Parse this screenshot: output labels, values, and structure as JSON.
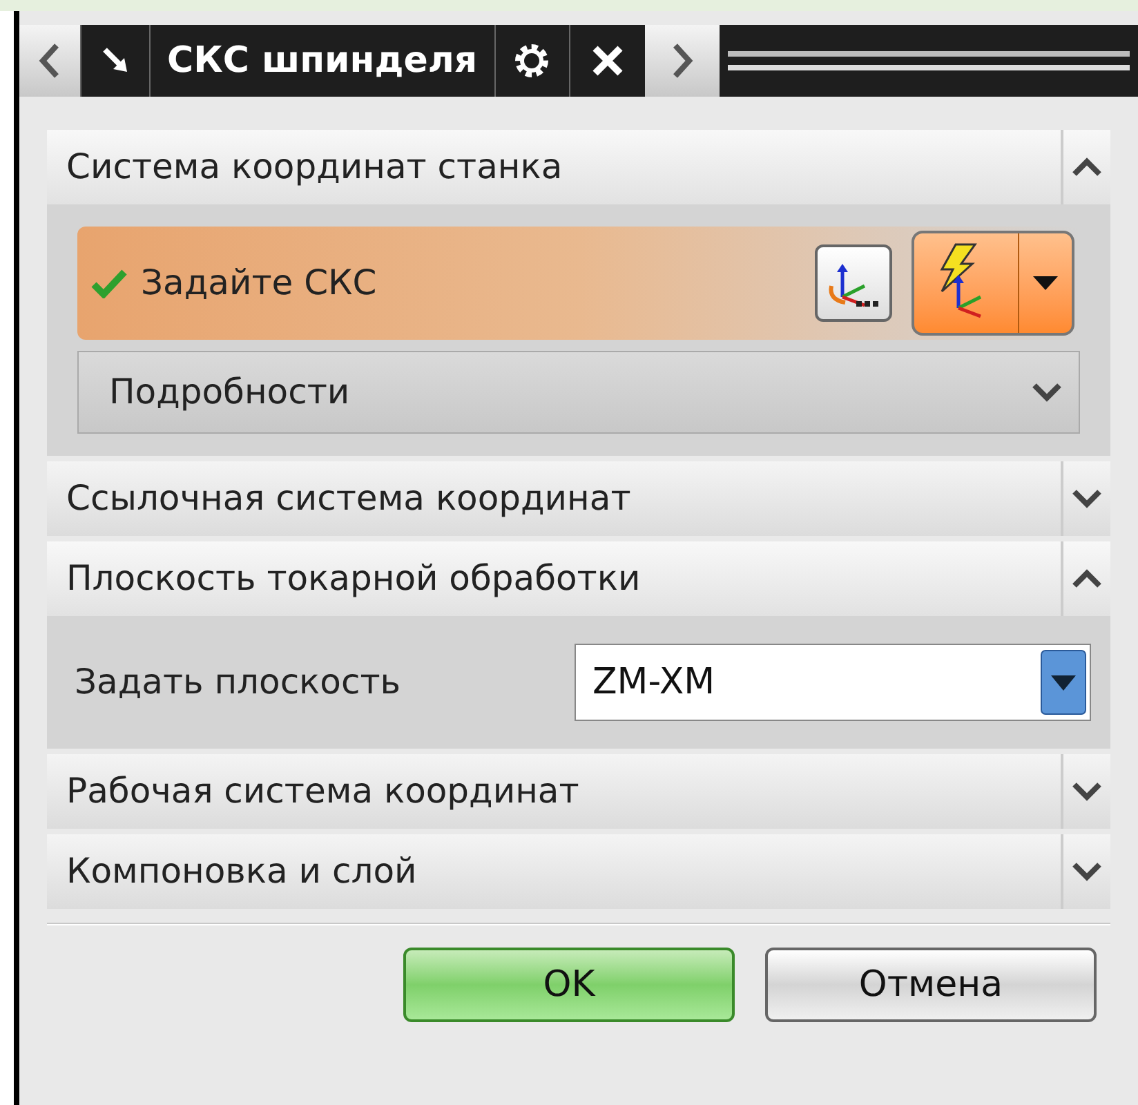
{
  "tab_bar": {
    "title": "СКС шпинделя"
  },
  "sections": [
    {
      "title": "Система координат станка",
      "expanded": true,
      "kind": "csys",
      "selector": {
        "label": "Задайте СКС",
        "done": true
      },
      "details": {
        "title": "Подробности",
        "expanded": false
      }
    },
    {
      "title": "Ссылочная система координат",
      "expanded": false
    },
    {
      "title": "Плоскость токарной обработки",
      "expanded": true,
      "kind": "plane",
      "field": {
        "label": "Задать плоскость",
        "value": "ZM-XM"
      }
    },
    {
      "title": "Рабочая система координат",
      "expanded": false
    },
    {
      "title": "Компоновка и слой",
      "expanded": false
    }
  ],
  "buttons": [
    {
      "label": "OK",
      "kind": "primary"
    },
    {
      "label": "Отмена",
      "kind": "secondary"
    }
  ]
}
